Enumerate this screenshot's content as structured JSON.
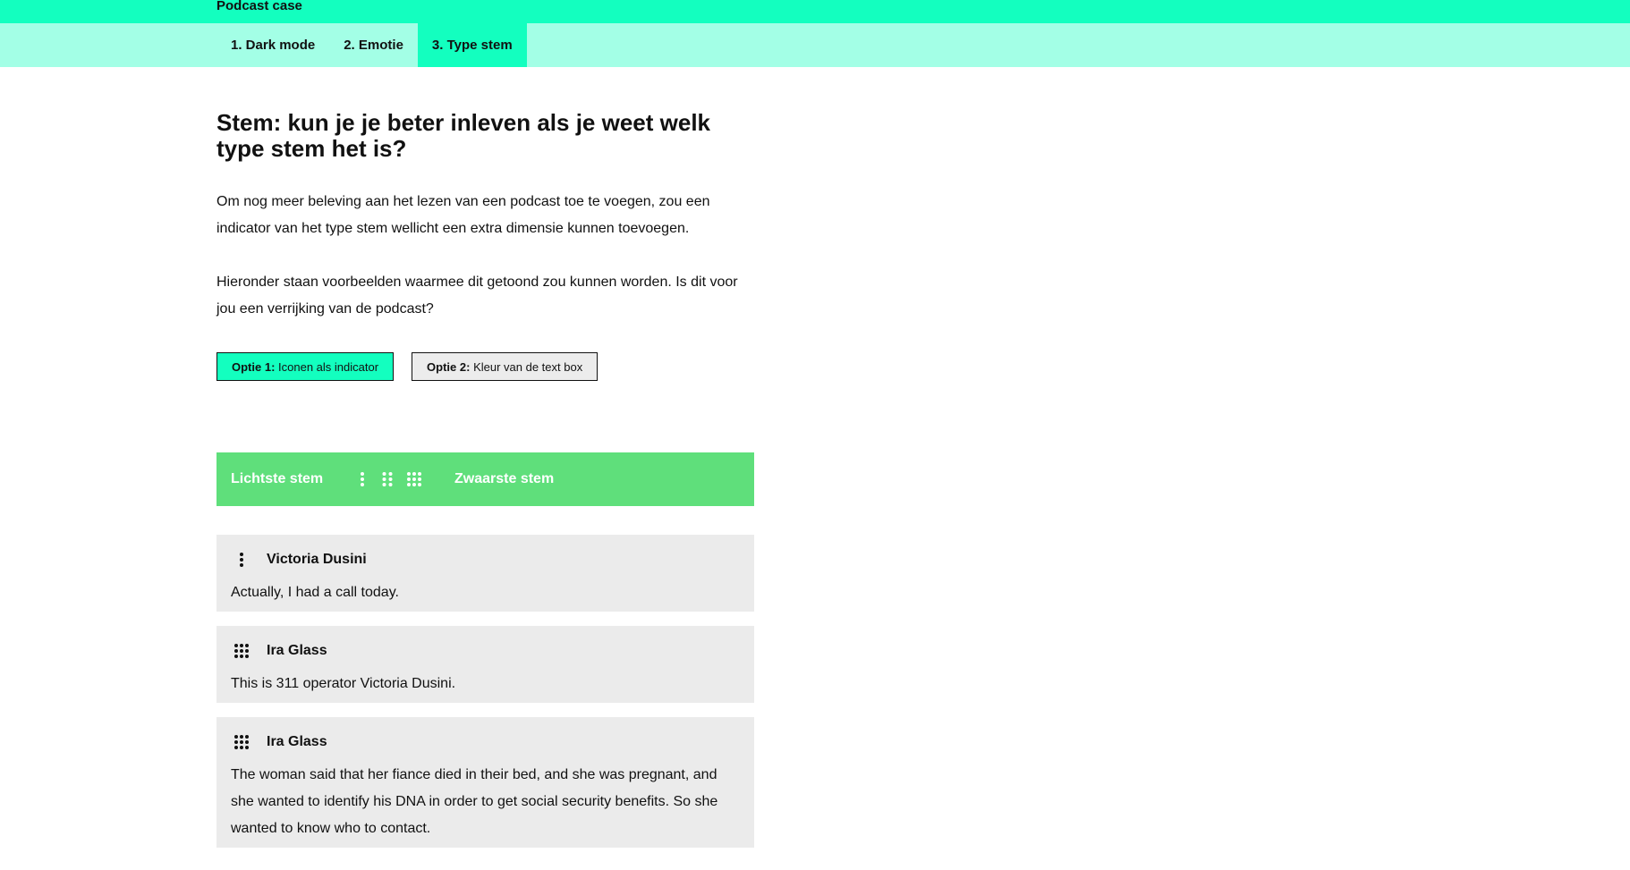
{
  "header": {
    "title": "Podcast case"
  },
  "tabs": [
    {
      "label": "1. Dark mode"
    },
    {
      "label": "2. Emotie"
    },
    {
      "label": "3. Type stem"
    }
  ],
  "main": {
    "heading": "Stem: kun je je beter inleven als je weet welk type stem het is?",
    "paragraph1": "Om nog meer beleving aan het lezen van een podcast toe te voegen, zou een indicator van het type stem wellicht een extra dimensie kunnen toevoegen.",
    "paragraph2": "Hieronder staan voorbeelden waarmee dit getoond zou kunnen worden. Is dit voor jou een verrijking van de podcast?",
    "options": [
      {
        "prefix": "Optie 1:",
        "label": "Iconen als indicator",
        "active": true
      },
      {
        "prefix": "Optie 2:",
        "label": "Kleur van de text box",
        "active": false
      }
    ],
    "legend": {
      "left": "Lichtste stem",
      "right": "Zwaarste stem",
      "icons": [
        "dots-1-icon",
        "dots-2-icon",
        "dots-3-icon"
      ],
      "color": "#5fdf7b"
    },
    "cards": [
      {
        "icon": "dots-1-icon",
        "speaker": "Victoria Dusini",
        "text": "Actually, I had a call today."
      },
      {
        "icon": "dots-3-icon",
        "speaker": "Ira Glass",
        "text": "This is 311 operator Victoria Dusini."
      },
      {
        "icon": "dots-3-icon",
        "speaker": "Ira Glass",
        "text": "The woman said that her fiance died in their bed, and she was pregnant, and she wanted to identify his DNA in order to get social security benefits. So she wanted to know who to contact."
      }
    ]
  },
  "colors": {
    "accent": "#13ffbf",
    "tabbar": "#a3ffe6",
    "card": "#ebebeb"
  }
}
